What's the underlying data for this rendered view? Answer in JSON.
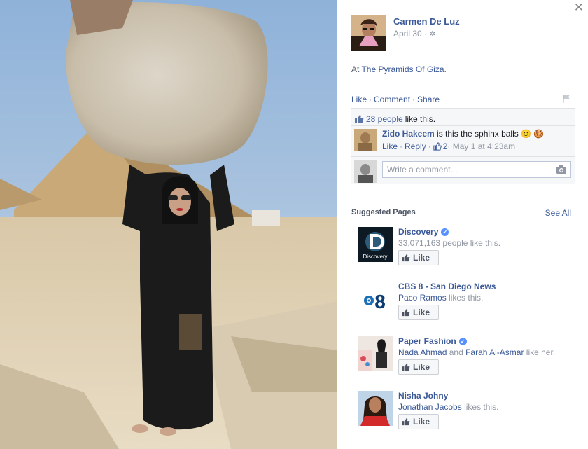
{
  "post": {
    "author": "Carmen De Luz",
    "date": "April 30 ·",
    "gear_icon": "gear-icon",
    "location_prefix": "At ",
    "location": "The Pyramids Of Giza",
    "location_suffix": "."
  },
  "actions": {
    "like": "Like",
    "comment": "Comment",
    "share": "Share",
    "separator": "·"
  },
  "likes": {
    "link": "28 people",
    "suffix": "like this."
  },
  "comment": {
    "author": "Zido Hakeem",
    "text": " is this the sphinx balls 🙂 🍪",
    "like": "Like",
    "reply": "Reply",
    "like_count": "2",
    "time": " · May 1 at 4:23am"
  },
  "compose": {
    "placeholder": "Write a comment..."
  },
  "suggested": {
    "title": "Suggested Pages",
    "see_all": "See All",
    "like_label": "Like",
    "items": [
      {
        "name": "Discovery",
        "verified": true,
        "sub_plain": "33,071,163 people like this.",
        "thumb_text": "Discovery"
      },
      {
        "name": "CBS 8 - San Diego News",
        "verified": false,
        "friend1": "Paco Ramos",
        "sub_plain": " likes this."
      },
      {
        "name": "Paper Fashion",
        "verified": true,
        "friend1": "Nada Ahmad",
        "and": " and ",
        "friend2": "Farah Al-Asmar",
        "sub_plain": " like her."
      },
      {
        "name": "Nisha Johny",
        "verified": false,
        "friend1": "Jonathan Jacobs",
        "sub_plain": " likes this."
      }
    ]
  },
  "colors": {
    "link": "#3b5998",
    "muted": "#9197a3",
    "verified": "#5890ff"
  }
}
